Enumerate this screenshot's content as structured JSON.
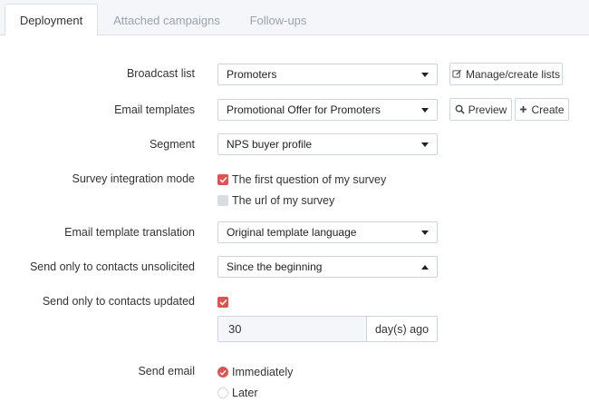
{
  "tabs": [
    {
      "label": "Deployment",
      "active": true
    },
    {
      "label": "Attached campaigns",
      "active": false
    },
    {
      "label": "Follow-ups",
      "active": false
    }
  ],
  "broadcast_list": {
    "label": "Broadcast list",
    "value": "Promoters",
    "manage_button": "Manage/create lists"
  },
  "email_templates": {
    "label": "Email templates",
    "value": "Promotional Offer for Promoters",
    "preview_button": "Preview",
    "create_button": "Create"
  },
  "segment": {
    "label": "Segment",
    "value": "NPS buyer profile"
  },
  "survey_integration": {
    "label": "Survey integration mode",
    "options": [
      {
        "label": "The first question of my survey",
        "checked": true
      },
      {
        "label": "The url of my survey",
        "checked": false
      }
    ]
  },
  "translation": {
    "label": "Email template translation",
    "value": "Original template language"
  },
  "unsolicited": {
    "label": "Send only to contacts unsolicited",
    "value": "Since the beginning"
  },
  "updated": {
    "label": "Send only to contacts updated",
    "checked": true,
    "days_value": "30",
    "days_suffix": "day(s) ago"
  },
  "send_email": {
    "label": "Send email",
    "options": [
      {
        "label": "Immediately",
        "selected": true
      },
      {
        "label": "Later",
        "selected": false
      }
    ]
  },
  "colors": {
    "accent": "#e0524f",
    "tab_bar": "#f4f6f9",
    "border": "#cfd4da"
  }
}
